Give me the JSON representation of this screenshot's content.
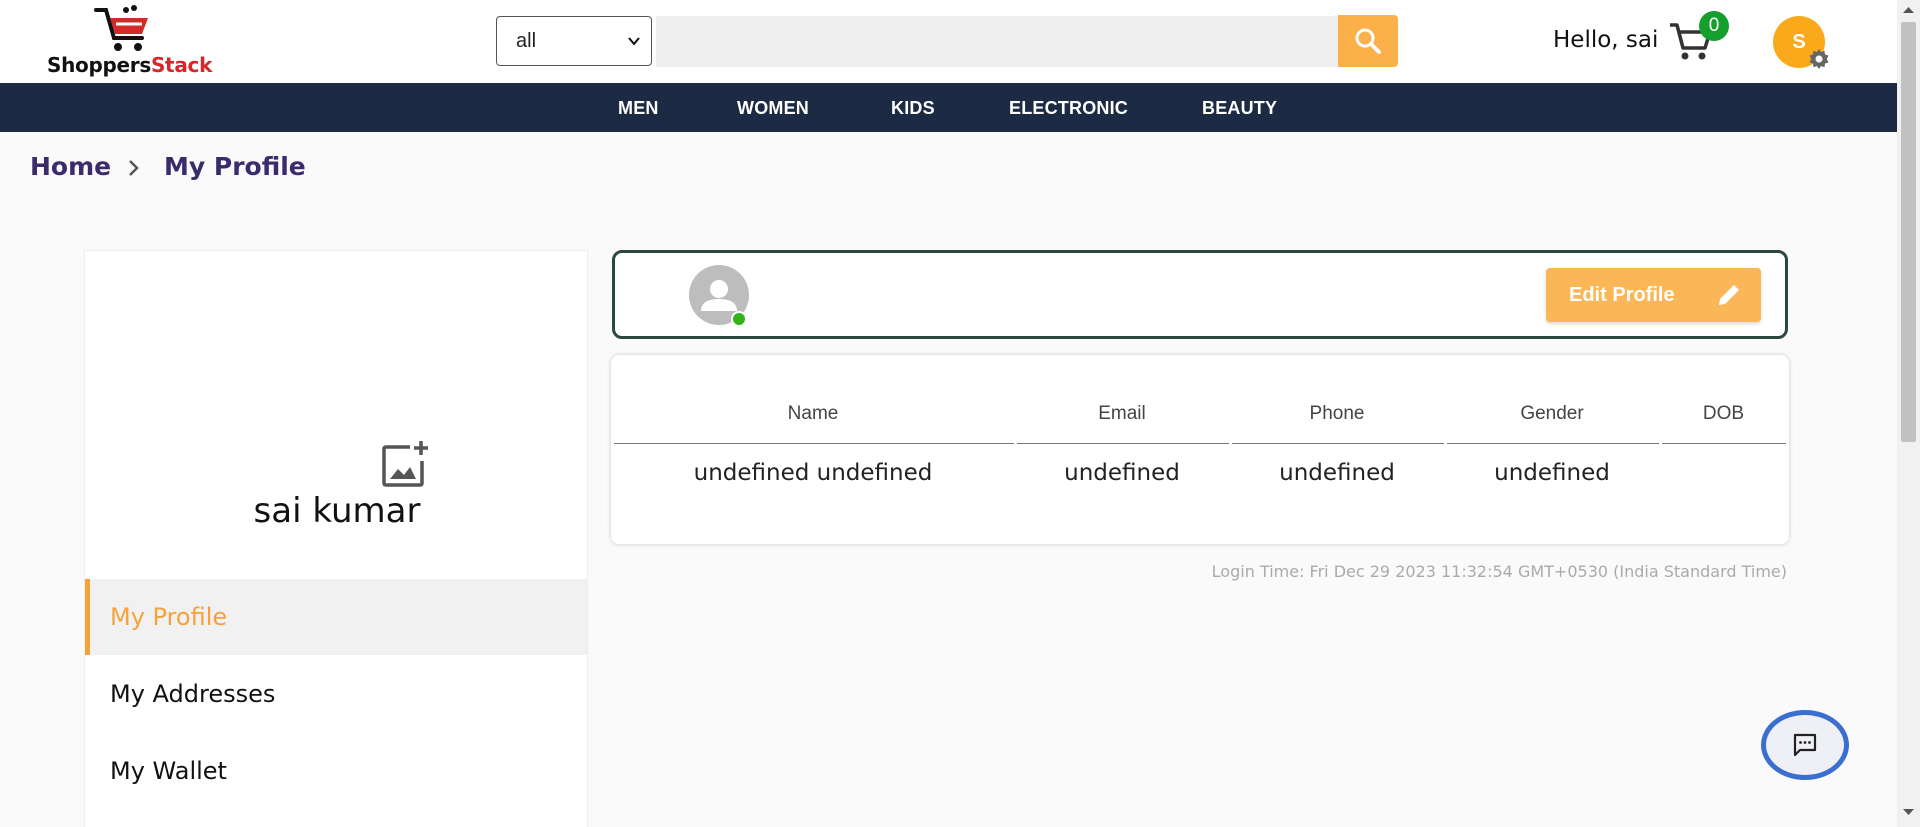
{
  "header": {
    "logo": {
      "part1": "Shoppers",
      "part2": "Stack"
    },
    "category_select": {
      "value": "all"
    },
    "search": {
      "placeholder": ""
    },
    "greeting": "Hello, sai",
    "cart_count": "0",
    "avatar_initial": "S"
  },
  "nav": {
    "items": [
      "MEN",
      "WOMEN",
      "KIDS",
      "ELECTRONIC",
      "BEAUTY"
    ]
  },
  "breadcrumb": {
    "home": "Home",
    "current": "My Profile"
  },
  "sidebar": {
    "name": "sai kumar",
    "items": [
      {
        "label": "My Profile",
        "active": true
      },
      {
        "label": "My Addresses",
        "active": false
      },
      {
        "label": "My Wallet",
        "active": false
      }
    ]
  },
  "profile": {
    "edit_label": "Edit Profile",
    "columns": [
      "Name",
      "Email",
      "Phone",
      "Gender",
      "DOB"
    ],
    "values": [
      "undefined undefined",
      "undefined",
      "undefined",
      "undefined",
      ""
    ],
    "login_time": "Login Time: Fri Dec 29 2023 11:32:54 GMT+0530 (India Standard Time)"
  },
  "colors": {
    "accent": "#f5a23a",
    "navbar": "#1c2a43",
    "cart_badge": "#15a02e",
    "online": "#33b31a"
  }
}
